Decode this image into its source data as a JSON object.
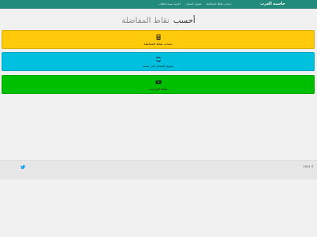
{
  "navbar": {
    "brand": "حاسبة الغرب",
    "items": [
      "حساب نقاط المفاضلة",
      "تحويل المعدل",
      "حاسبة نسبة الطلاب"
    ]
  },
  "heading": {
    "part1": "أحسب",
    "part2": "نقاط المفاضلة"
  },
  "cards": [
    {
      "label": "حساب نقاط المفاضلة",
      "icon": "calculator-icon",
      "color": "#ffca0a"
    },
    {
      "label": "تحويل المعدل الى نسبة",
      "icon": "refresh-icon",
      "color": "#00c0e0"
    },
    {
      "label": "نقاط الوزارات",
      "icon": "money-icon",
      "color": "#00bf00"
    }
  ],
  "footer": {
    "copyright": "2024 ©",
    "social_icon": "twitter-icon"
  }
}
